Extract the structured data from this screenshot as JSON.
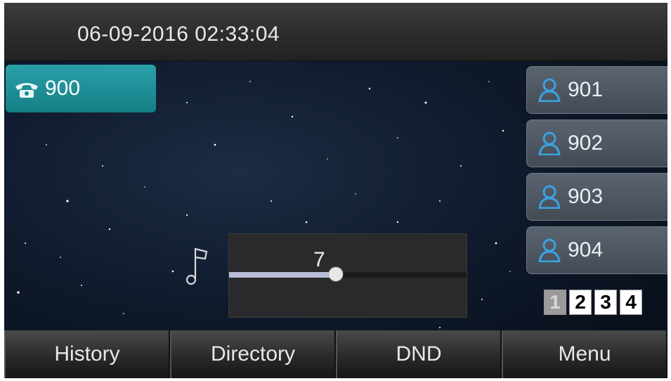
{
  "status_bar": {
    "datetime": "06-09-2016 02:33:04"
  },
  "line_key": {
    "label": "900",
    "icon": "phone-icon"
  },
  "dss_keys": [
    {
      "label": "901",
      "icon": "contact-icon"
    },
    {
      "label": "902",
      "icon": "contact-icon"
    },
    {
      "label": "903",
      "icon": "contact-icon"
    },
    {
      "label": "904",
      "icon": "contact-icon"
    }
  ],
  "pages": {
    "items": [
      "1",
      "2",
      "3",
      "4"
    ],
    "active": "1"
  },
  "volume": {
    "value": "7",
    "level_fraction": 0.45,
    "icon": "music-note-icon"
  },
  "softkeys": [
    "History",
    "Directory",
    "DND",
    "Menu"
  ],
  "colors": {
    "line_key": "#1f9aa3",
    "dss_icon": "#3aa3e0",
    "accent_fill": "#b8bcd8"
  }
}
